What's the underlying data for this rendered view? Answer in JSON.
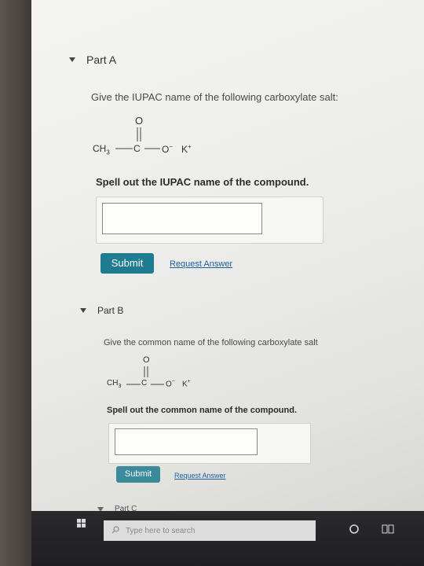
{
  "partA": {
    "title": "Part A",
    "question": "Give the IUPAC name of the following carboxylate salt:",
    "instruction": "Spell out the IUPAC name of the compound.",
    "input_value": "",
    "submit_label": "Submit",
    "request_label": "Request Answer"
  },
  "partB": {
    "title": "Part B",
    "question": "Give the common name of the following carboxylate salt",
    "instruction": "Spell out the common name of the compound.",
    "input_value": "",
    "submit_label": "Submit",
    "request_label": "Request Answer"
  },
  "partC": {
    "title": "Part C"
  },
  "molecule": {
    "oxygen": "O",
    "ch3": "CH",
    "ch3_sub": "3",
    "carbon": "C",
    "o_minus": "O",
    "minus": "−",
    "potassium": "K",
    "plus": "+"
  },
  "taskbar": {
    "search_placeholder": "Type here to search",
    "icons": [
      "windows-icon",
      "search-icon",
      "cortana-icon",
      "task-view-icon"
    ]
  },
  "colors": {
    "submit_bg": "#1f7b8f",
    "link": "#1e5f9e"
  }
}
